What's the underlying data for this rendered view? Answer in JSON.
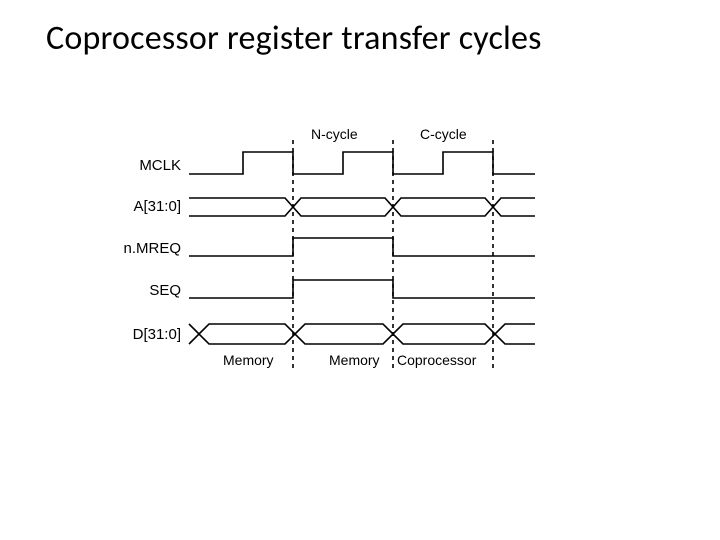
{
  "title": "Coprocessor register transfer cycles",
  "phases": {
    "n": "N-cycle",
    "c": "C-cycle"
  },
  "signals": {
    "mclk": "MCLK",
    "addr": "A[31:0]",
    "nmreq": "n.MREQ",
    "seq": "SEQ",
    "data": "D[31:0]"
  },
  "bus_labels": {
    "mem1": "Memory",
    "mem2": "Memory",
    "cop": "Coprocessor"
  }
}
